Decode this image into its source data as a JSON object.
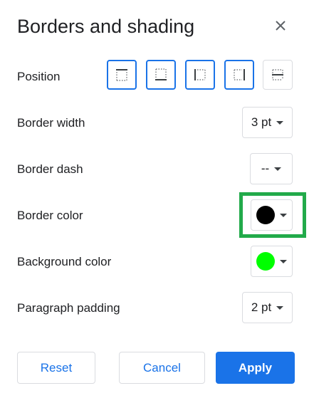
{
  "dialog": {
    "title": "Borders and shading"
  },
  "icons": {
    "close": "close-icon",
    "border_top": "border-top-icon",
    "border_bottom": "border-bottom-icon",
    "border_left": "border-left-icon",
    "border_right": "border-right-icon",
    "border_between": "border-between-icon"
  },
  "rows": {
    "position_label": "Position",
    "border_width_label": "Border width",
    "border_width_value": "3 pt",
    "border_dash_label": "Border dash",
    "border_dash_value": "--",
    "border_color_label": "Border color",
    "border_color_value": "#000000",
    "background_color_label": "Background color",
    "background_color_value": "#00ff00",
    "padding_label": "Paragraph padding",
    "padding_value": "2 pt"
  },
  "position_states": {
    "top": true,
    "bottom": true,
    "left": true,
    "right": true,
    "between": false
  },
  "buttons": {
    "reset": "Reset",
    "cancel": "Cancel",
    "apply": "Apply"
  },
  "colors": {
    "accent": "#1a73e8",
    "highlight": "#22aa4a"
  }
}
